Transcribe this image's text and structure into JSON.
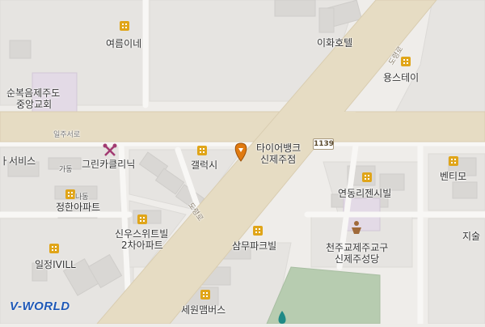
{
  "map": {
    "roads": {
      "ilju_seoro": "일주서로",
      "doryeongno_upper": "도령로",
      "doryeongno_lower": "도령로",
      "route_number": "1139"
    },
    "places": {
      "yeoreumine": "여름이네",
      "ihwa_hotel": "이화호텔",
      "yongs_stay": "용스테이",
      "church_line1": "순복음제주도",
      "church_line2": "중앙교회",
      "seobiseu": "ㅏ서비스",
      "green_clinic": "그린카클리닉",
      "gadong_label": "가동",
      "gallery_si": "갤럭시",
      "tire_bank_line1": "타이어뱅크",
      "tire_bank_line2": "신제주점",
      "bentimo": "벤티모",
      "nadong_label": "나동",
      "jeonghan_apt": "정한아파트",
      "yeondong_richen": "연동리젠시빌",
      "siwoo_line1": "신우스위트빌",
      "siwoo_line2": "2차아파트",
      "samu_park": "삼무파크빌",
      "catholic_line1": "천주교제주교구",
      "catholic_line2": "신제주성당",
      "jisul": "지술",
      "iljeong_ivill": "일정IVILL",
      "sewon_mbus": "세원맴버스"
    }
  },
  "branding": {
    "logo_prefix": "V",
    "logo_text": "-WORLD"
  },
  "colors": {
    "background": "#efedea",
    "main_road": "#e6dcc3",
    "block": "#e6e4e1",
    "building": "#d9d7d4",
    "church_area": "#e3dae6",
    "park": "#b7ccb0",
    "poi_building": "#e0a519",
    "pin": "#e07a10",
    "logo": "#1e58b7"
  }
}
